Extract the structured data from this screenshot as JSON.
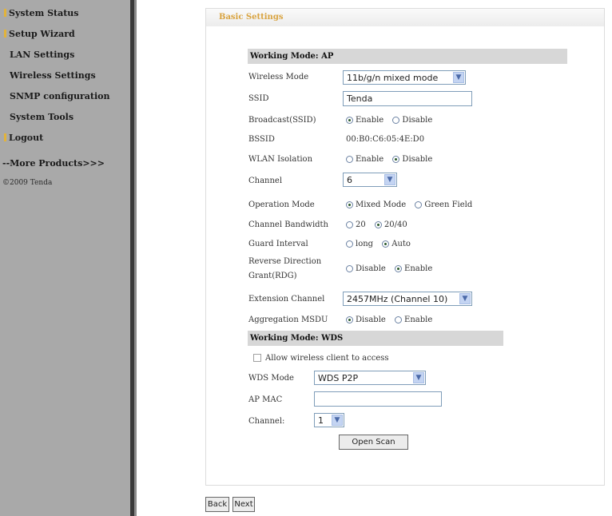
{
  "sidebar": {
    "items": [
      {
        "label": "System Status"
      },
      {
        "label": "Setup Wizard"
      },
      {
        "label": "LAN Settings"
      },
      {
        "label": "Wireless Settings"
      },
      {
        "label": "SNMP configuration"
      },
      {
        "label": "System Tools"
      },
      {
        "label": "Logout"
      }
    ],
    "more_products": "--More Products>>>",
    "copyright": "©2009 Tenda"
  },
  "panel": {
    "title": "Basic Settings"
  },
  "ap_section": {
    "title": "Working Mode: AP",
    "wireless_mode": {
      "label": "Wireless Mode",
      "value": "11b/g/n mixed mode"
    },
    "ssid": {
      "label": "SSID",
      "value": "Tenda"
    },
    "broadcast": {
      "label": "Broadcast(SSID)",
      "opt1": "Enable",
      "opt2": "Disable",
      "selected": "Enable"
    },
    "bssid": {
      "label": "BSSID",
      "value": "00:B0:C6:05:4E:D0"
    },
    "wlan_isolation": {
      "label": "WLAN Isolation",
      "opt1": "Enable",
      "opt2": "Disable",
      "selected": "Disable"
    },
    "channel": {
      "label": "Channel",
      "value": "6"
    },
    "operation_mode": {
      "label": "Operation Mode",
      "opt1": "Mixed Mode",
      "opt2": "Green Field",
      "selected": "Mixed Mode"
    },
    "channel_bandwidth": {
      "label": "Channel Bandwidth",
      "opt1": "20",
      "opt2": "20/40",
      "selected": "20/40"
    },
    "guard_interval": {
      "label": "Guard Interval",
      "opt1": "long",
      "opt2": "Auto",
      "selected": "Auto"
    },
    "rdg": {
      "label1": "Reverse Direction",
      "label2": "Grant(RDG)",
      "opt1": "Disable",
      "opt2": "Enable",
      "selected": "Enable"
    },
    "extension_channel": {
      "label": "Extension Channel",
      "value": "2457MHz (Channel 10)"
    },
    "aggregation_msdu": {
      "label": "Aggregation MSDU",
      "opt1": "Disable",
      "opt2": "Enable",
      "selected": "Disable"
    }
  },
  "wds_section": {
    "title": "Working Mode: WDS",
    "allow_client": "Allow wireless client to access",
    "wds_mode": {
      "label": "WDS Mode",
      "value": "WDS P2P"
    },
    "ap_mac": {
      "label": "AP MAC",
      "value": ""
    },
    "channel": {
      "label": "Channel:",
      "value": "1"
    },
    "open_scan": "Open Scan"
  },
  "footer": {
    "back": "Back",
    "next": "Next"
  }
}
